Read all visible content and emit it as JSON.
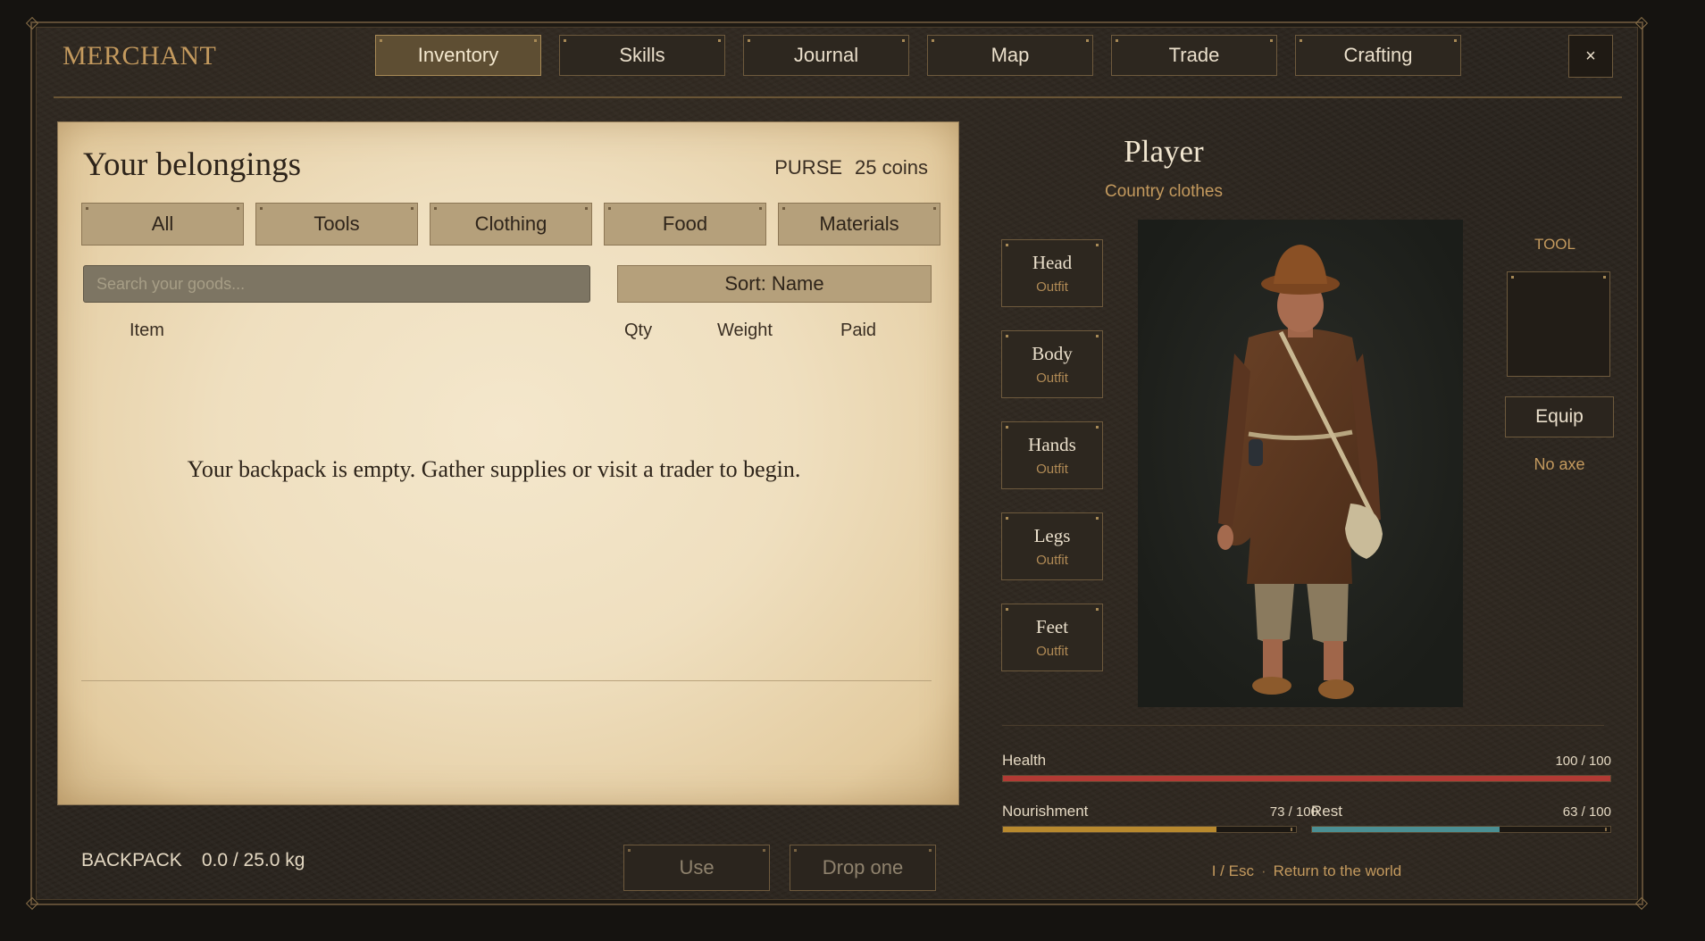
{
  "header": {
    "brand": "MERCHANT",
    "tabs": [
      {
        "label": "Inventory",
        "active": true
      },
      {
        "label": "Skills",
        "active": false
      },
      {
        "label": "Journal",
        "active": false
      },
      {
        "label": "Map",
        "active": false
      },
      {
        "label": "Trade",
        "active": false
      },
      {
        "label": "Crafting",
        "active": false
      }
    ],
    "close_label": "×"
  },
  "inventory": {
    "title": "Your belongings",
    "purse_label": "PURSE",
    "purse_value": "25 coins",
    "filters": [
      "All",
      "Tools",
      "Clothing",
      "Food",
      "Materials"
    ],
    "search_placeholder": "Search your goods...",
    "search_value": "",
    "sort_label": "Sort: Name",
    "columns": {
      "item": "Item",
      "qty": "Qty",
      "weight": "Weight",
      "paid": "Paid"
    },
    "rows": [],
    "empty_message": "Your backpack is empty. Gather supplies or visit a trader to begin."
  },
  "footer": {
    "backpack_label": "BACKPACK",
    "backpack_value": "0.0 / 25.0 kg",
    "use_label": "Use",
    "drop_label": "Drop one"
  },
  "character": {
    "name": "Player",
    "outfit": "Country clothes",
    "slots": [
      {
        "name": "Head",
        "value": "Outfit"
      },
      {
        "name": "Body",
        "value": "Outfit"
      },
      {
        "name": "Hands",
        "value": "Outfit"
      },
      {
        "name": "Legs",
        "value": "Outfit"
      },
      {
        "name": "Feet",
        "value": "Outfit"
      }
    ],
    "tool_label": "TOOL",
    "equip_label": "Equip",
    "tool_status": "No axe"
  },
  "stats": {
    "health": {
      "label": "Health",
      "value": "100 / 100",
      "fraction": 1.0,
      "color": "#b23a34"
    },
    "nourishment": {
      "label": "Nourishment",
      "value": "73 / 100",
      "fraction": 0.73,
      "color": "#b8892e"
    },
    "rest": {
      "label": "Rest",
      "value": "63 / 100",
      "fraction": 0.63,
      "color": "#4b8f93"
    }
  },
  "hint": {
    "keys": "I / Esc",
    "separator": "·",
    "text": "Return to the world"
  }
}
